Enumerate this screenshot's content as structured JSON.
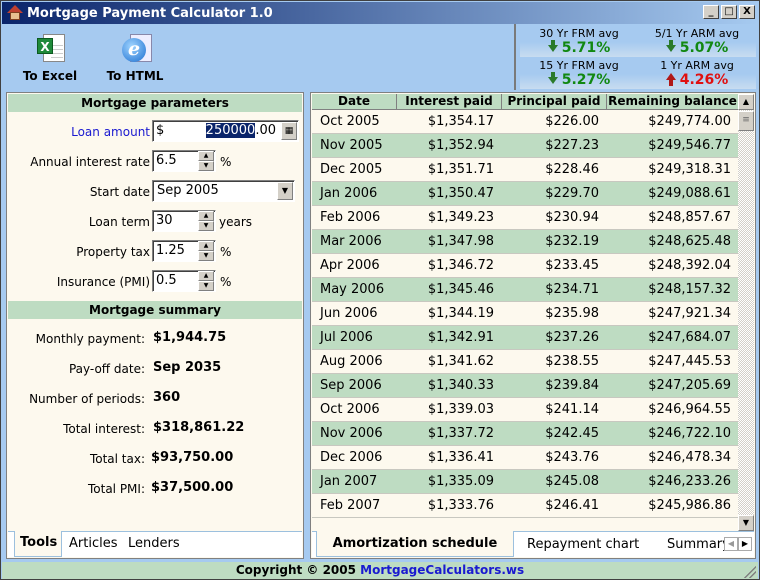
{
  "window": {
    "title": "Mortgage Payment Calculator 1.0",
    "controls": {
      "minimize": "_",
      "maximize": "□",
      "close": "X"
    }
  },
  "toolbar": {
    "excel_label": "To Excel",
    "html_label": "To HTML"
  },
  "rates": [
    {
      "name": "30 Yr FRM avg",
      "value": "5.71%",
      "trend": "down"
    },
    {
      "name": "5/1 Yr ARM avg",
      "value": "5.07%",
      "trend": "down"
    },
    {
      "name": "15 Yr FRM avg",
      "value": "5.27%",
      "trend": "down"
    },
    {
      "name": "1 Yr ARM avg",
      "value": "4.26%",
      "trend": "up"
    }
  ],
  "parameters": {
    "heading": "Mortgage parameters",
    "loan_amount": {
      "label": "Loan amount",
      "prefix": "$",
      "value_selected": "250000",
      "value_rest": ".00"
    },
    "interest_rate": {
      "label": "Annual interest rate",
      "value": "6.5",
      "unit": "%"
    },
    "start_date": {
      "label": "Start date",
      "value": "Sep 2005"
    },
    "loan_term": {
      "label": "Loan term",
      "value": "30",
      "unit": "years"
    },
    "property_tax": {
      "label": "Property tax",
      "value": "1.25",
      "unit": "%"
    },
    "insurance": {
      "label": "Insurance (PMI)",
      "value": "0.5",
      "unit": "%"
    }
  },
  "summary": {
    "heading": "Mortgage summary",
    "items": [
      {
        "label": "Monthly payment:",
        "value": "$1,944.75"
      },
      {
        "label": "Pay-off date:",
        "value": "Sep 2035"
      },
      {
        "label": "Number of periods:",
        "value": "360"
      },
      {
        "label": "Total interest:",
        "value": "$318,861.22"
      },
      {
        "label": "Total tax:",
        "value": "$93,750.00"
      },
      {
        "label": "Total PMI:",
        "value": "$37,500.00"
      }
    ]
  },
  "left_tabs": [
    "Tools",
    "Articles",
    "Lenders"
  ],
  "schedule": {
    "columns": [
      "Date",
      "Interest paid",
      "Principal paid",
      "Remaining balance"
    ],
    "rows": [
      [
        "Oct 2005",
        "$1,354.17",
        "$226.00",
        "$249,774.00"
      ],
      [
        "Nov 2005",
        "$1,352.94",
        "$227.23",
        "$249,546.77"
      ],
      [
        "Dec 2005",
        "$1,351.71",
        "$228.46",
        "$249,318.31"
      ],
      [
        "Jan 2006",
        "$1,350.47",
        "$229.70",
        "$249,088.61"
      ],
      [
        "Feb 2006",
        "$1,349.23",
        "$230.94",
        "$248,857.67"
      ],
      [
        "Mar 2006",
        "$1,347.98",
        "$232.19",
        "$248,625.48"
      ],
      [
        "Apr 2006",
        "$1,346.72",
        "$233.45",
        "$248,392.04"
      ],
      [
        "May 2006",
        "$1,345.46",
        "$234.71",
        "$248,157.32"
      ],
      [
        "Jun 2006",
        "$1,344.19",
        "$235.98",
        "$247,921.34"
      ],
      [
        "Jul 2006",
        "$1,342.91",
        "$237.26",
        "$247,684.07"
      ],
      [
        "Aug 2006",
        "$1,341.62",
        "$238.55",
        "$247,445.53"
      ],
      [
        "Sep 2006",
        "$1,340.33",
        "$239.84",
        "$247,205.69"
      ],
      [
        "Oct 2006",
        "$1,339.03",
        "$241.14",
        "$246,964.55"
      ],
      [
        "Nov 2006",
        "$1,337.72",
        "$242.45",
        "$246,722.10"
      ],
      [
        "Dec 2006",
        "$1,336.41",
        "$243.76",
        "$246,478.34"
      ],
      [
        "Jan 2007",
        "$1,335.09",
        "$245.08",
        "$246,233.26"
      ],
      [
        "Feb 2007",
        "$1,333.76",
        "$246.41",
        "$245,986.86"
      ]
    ]
  },
  "right_tabs": [
    "Amortization schedule",
    "Repayment chart",
    "Summary"
  ],
  "status": {
    "text": "Copyright © 2005 ",
    "link": "MortgageCalculators.ws"
  },
  "colors": {
    "accent_green": "#bedcc2",
    "rate_down": "#118811",
    "rate_up": "#e01010",
    "link_blue": "#1a1ad0"
  }
}
